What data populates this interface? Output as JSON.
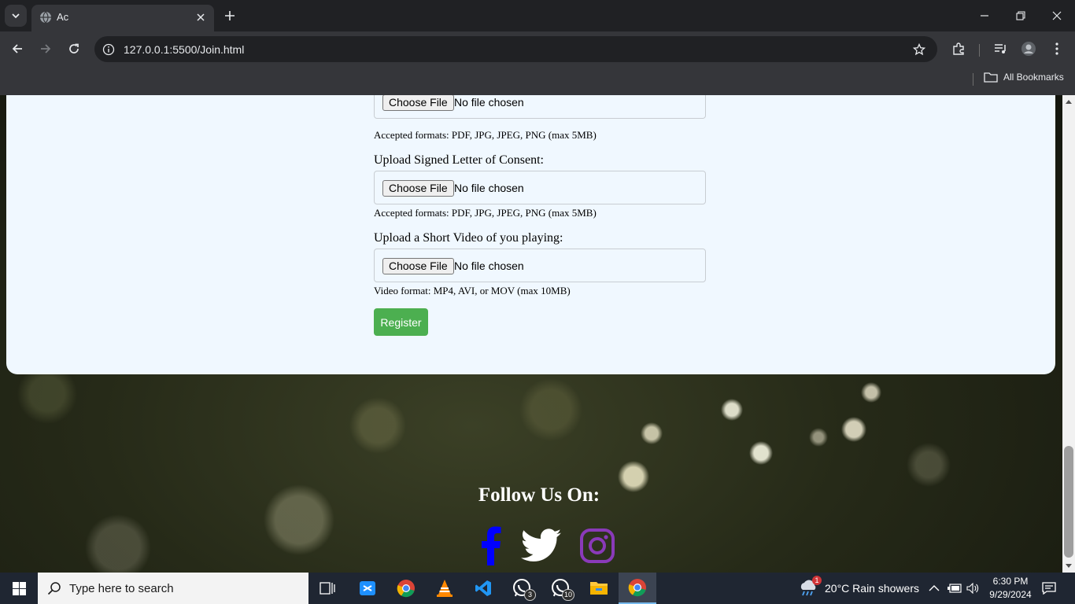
{
  "browser": {
    "tab_title": "Ac",
    "url": "127.0.0.1:5500/Join.html",
    "bookmarks_label": "All Bookmarks"
  },
  "form": {
    "file_button_label": "Choose File",
    "file_status": "No file chosen",
    "field1_hint": "Accepted formats: PDF, JPG, JPEG, PNG (max 5MB)",
    "field2_label": "Upload Signed Letter of Consent:",
    "field2_hint": "Accepted formats: PDF, JPG, JPEG, PNG (max 5MB)",
    "field3_label": "Upload a Short Video of you playing:",
    "field3_hint": "Video format: MP4, AVI, or MOV (max 10MB)",
    "register_label": "Register"
  },
  "footer": {
    "follow_heading": "Follow Us On:",
    "social": [
      "facebook-icon",
      "twitter-icon",
      "instagram-icon"
    ],
    "colors": {
      "facebook": "#0000ff",
      "twitter": "#ffffff",
      "instagram": "#8a3ab9"
    }
  },
  "taskbar": {
    "search_placeholder": "Type here to search",
    "whatsapp_badge_1": "3",
    "whatsapp_badge_2": "10",
    "weather_badge": "1",
    "weather": "20°C  Rain showers",
    "time": "6:30 PM",
    "date": "9/29/2024"
  },
  "colors": {
    "chrome_dark": "#202124",
    "chrome_toolbar": "#35363a",
    "card_background": "#f0f8ff",
    "register_button": "#4caf50",
    "taskbar": "#1f2632"
  }
}
